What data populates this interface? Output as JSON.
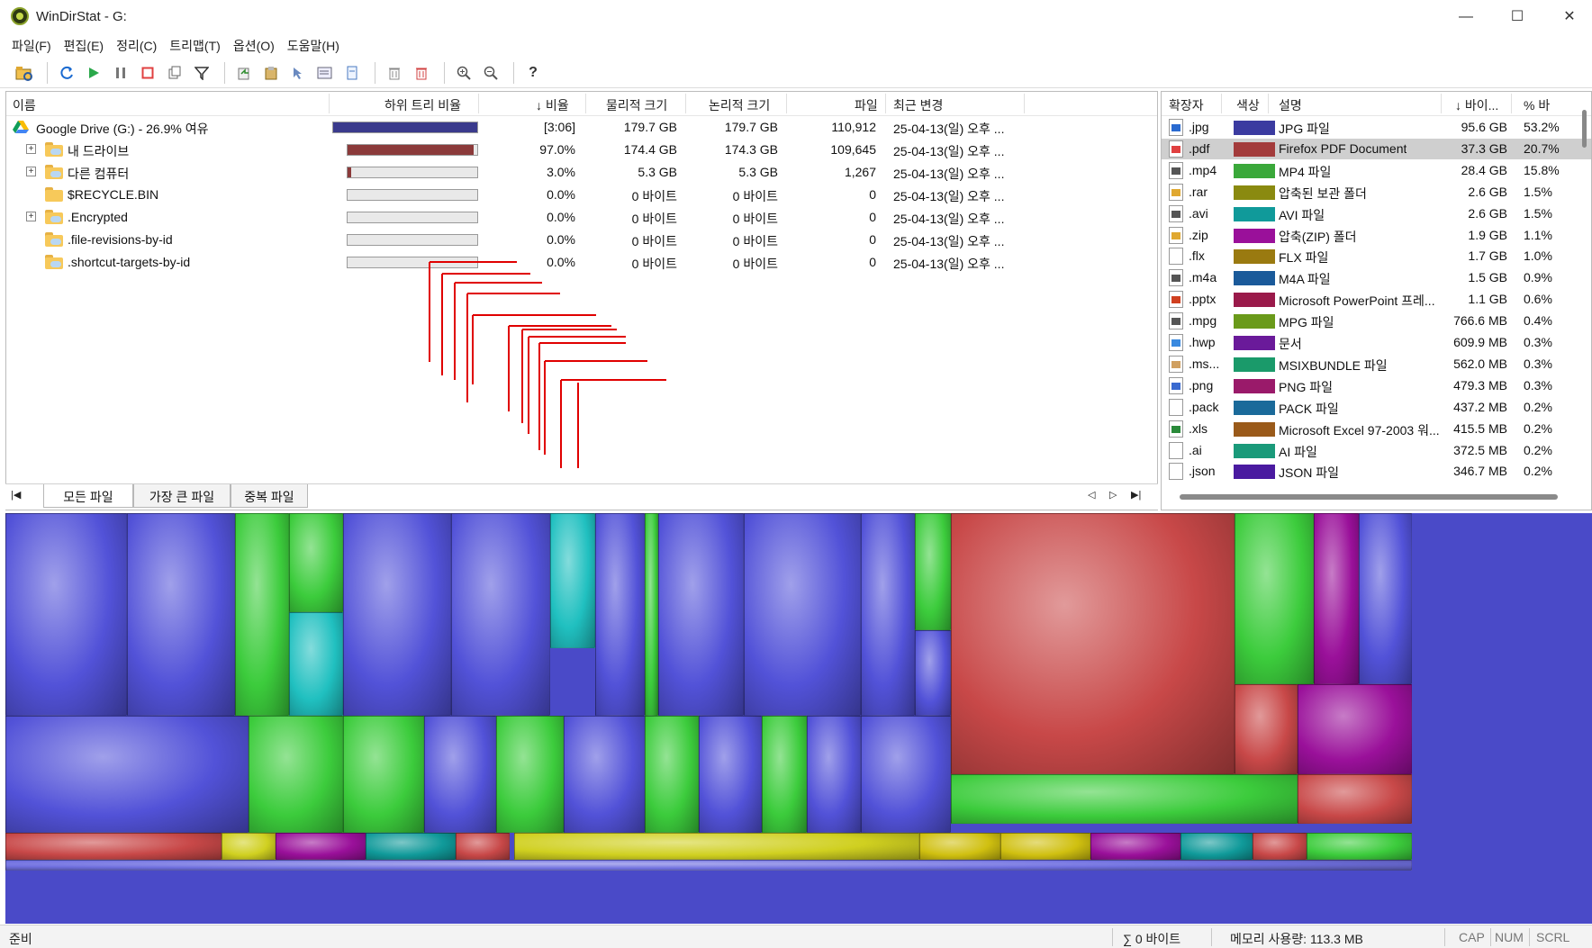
{
  "window": {
    "title": "WinDirStat - G:",
    "minimize": "—",
    "maximize": "☐",
    "close": "✕"
  },
  "menu": [
    "파일(F)",
    "편집(E)",
    "정리(C)",
    "트리맵(T)",
    "옵션(O)",
    "도움말(H)"
  ],
  "toolbar": {
    "help": "?"
  },
  "tree": {
    "columns": {
      "name": "이름",
      "subtree_ratio": "하위 트리 비율",
      "ratio": "↓ 비율",
      "physical": "물리적 크기",
      "logical": "논리적 크기",
      "files": "파일",
      "modified": "최근 변경"
    },
    "rows": [
      {
        "name": "Google Drive (G:) - 26.9% 여유",
        "ratio": "[3:06]",
        "physical": "179.7 GB",
        "logical": "179.7 GB",
        "files": "110,912",
        "modified": "25-04-13(일) 오후 ...",
        "bar": 1.0,
        "bar_color": "#3a3a8c",
        "expander": "",
        "icon": "gdrive-icon"
      },
      {
        "name": "내 드라이브",
        "ratio": "97.0%",
        "physical": "174.4 GB",
        "logical": "174.3 GB",
        "files": "109,645",
        "modified": "25-04-13(일) 오후 ...",
        "bar": 0.97,
        "bar_color": "#8b3a3a",
        "expander": "+",
        "icon": "cloud-folder-icon"
      },
      {
        "name": "다른 컴퓨터",
        "ratio": "3.0%",
        "physical": "5.3 GB",
        "logical": "5.3 GB",
        "files": "1,267",
        "modified": "25-04-13(일) 오후 ...",
        "bar": 0.03,
        "bar_color": "#8b3a3a",
        "expander": "+",
        "icon": "cloud-folder-icon"
      },
      {
        "name": "$RECYCLE.BIN",
        "ratio": "0.0%",
        "physical": "0 바이트",
        "logical": "0 바이트",
        "files": "0",
        "modified": "25-04-13(일) 오후 ...",
        "bar": 0,
        "bar_color": "#8b3a3a",
        "expander": "",
        "icon": "folder-icon"
      },
      {
        "name": ".Encrypted",
        "ratio": "0.0%",
        "physical": "0 바이트",
        "logical": "0 바이트",
        "files": "0",
        "modified": "25-04-13(일) 오후 ...",
        "bar": 0,
        "bar_color": "#8b3a3a",
        "expander": "+",
        "icon": "cloud-folder-icon"
      },
      {
        "name": ".file-revisions-by-id",
        "ratio": "0.0%",
        "physical": "0 바이트",
        "logical": "0 바이트",
        "files": "0",
        "modified": "25-04-13(일) 오후 ...",
        "bar": 0,
        "bar_color": "#8b3a3a",
        "expander": "",
        "icon": "cloud-folder-icon"
      },
      {
        "name": ".shortcut-targets-by-id",
        "ratio": "0.0%",
        "physical": "0 바이트",
        "logical": "0 바이트",
        "files": "0",
        "modified": "25-04-13(일) 오후 ...",
        "bar": 0,
        "bar_color": "#8b3a3a",
        "expander": "",
        "icon": "cloud-folder-icon"
      }
    ]
  },
  "tabs": [
    "모든 파일",
    "가장 큰 파일",
    "중복 파일"
  ],
  "extensions": {
    "columns": {
      "ext": "확장자",
      "color": "색상",
      "desc": "설명",
      "bytes": "↓ 바이...",
      "percent": "% 바"
    },
    "rows": [
      {
        "ext": ".jpg",
        "color": "#3b3ba0",
        "desc": "JPG 파일",
        "bytes": "95.6 GB",
        "percent": "53.2%"
      },
      {
        "ext": ".pdf",
        "color": "#a33b3b",
        "desc": "Firefox PDF Document",
        "bytes": "37.3 GB",
        "percent": "20.7%"
      },
      {
        "ext": ".mp4",
        "color": "#3aa83a",
        "desc": "MP4 파일",
        "bytes": "28.4 GB",
        "percent": "15.8%"
      },
      {
        "ext": ".rar",
        "color": "#8a8a10",
        "desc": "압축된 보관 폴더",
        "bytes": "2.6 GB",
        "percent": "1.5%"
      },
      {
        "ext": ".avi",
        "color": "#109a9a",
        "desc": "AVI 파일",
        "bytes": "2.6 GB",
        "percent": "1.5%"
      },
      {
        "ext": ".zip",
        "color": "#9a109a",
        "desc": "압축(ZIP) 폴더",
        "bytes": "1.9 GB",
        "percent": "1.1%"
      },
      {
        "ext": ".flx",
        "color": "#9a7a10",
        "desc": "FLX 파일",
        "bytes": "1.7 GB",
        "percent": "1.0%"
      },
      {
        "ext": ".m4a",
        "color": "#1a5a9a",
        "desc": "M4A 파일",
        "bytes": "1.5 GB",
        "percent": "0.9%"
      },
      {
        "ext": ".pptx",
        "color": "#9a1a4a",
        "desc": "Microsoft PowerPoint 프레...",
        "bytes": "1.1 GB",
        "percent": "0.6%"
      },
      {
        "ext": ".mpg",
        "color": "#6a9a1a",
        "desc": "MPG 파일",
        "bytes": "766.6 MB",
        "percent": "0.4%"
      },
      {
        "ext": ".hwp",
        "color": "#6a1a9a",
        "desc": "문서",
        "bytes": "609.9 MB",
        "percent": "0.3%"
      },
      {
        "ext": ".ms...",
        "color": "#1a9a6a",
        "desc": "MSIXBUNDLE 파일",
        "bytes": "562.0 MB",
        "percent": "0.3%"
      },
      {
        "ext": ".png",
        "color": "#9a1a6a",
        "desc": "PNG 파일",
        "bytes": "479.3 MB",
        "percent": "0.3%"
      },
      {
        "ext": ".pack",
        "color": "#1a6a9a",
        "desc": "PACK 파일",
        "bytes": "437.2 MB",
        "percent": "0.2%"
      },
      {
        "ext": ".xls",
        "color": "#9a5a1a",
        "desc": "Microsoft Excel 97-2003 워...",
        "bytes": "415.5 MB",
        "percent": "0.2%"
      },
      {
        "ext": ".ai",
        "color": "#1a9a7a",
        "desc": "AI 파일",
        "bytes": "372.5 MB",
        "percent": "0.2%"
      },
      {
        "ext": ".json",
        "color": "#4a1aa0",
        "desc": "JSON 파일",
        "bytes": "346.7 MB",
        "percent": "0.2%"
      }
    ]
  },
  "status": {
    "ready": "준비",
    "sum": "∑ 0 바이트",
    "memory": "메모리 사용량: 113.3 MB",
    "cap": "CAP",
    "num": "NUM",
    "scrl": "SCRL"
  }
}
